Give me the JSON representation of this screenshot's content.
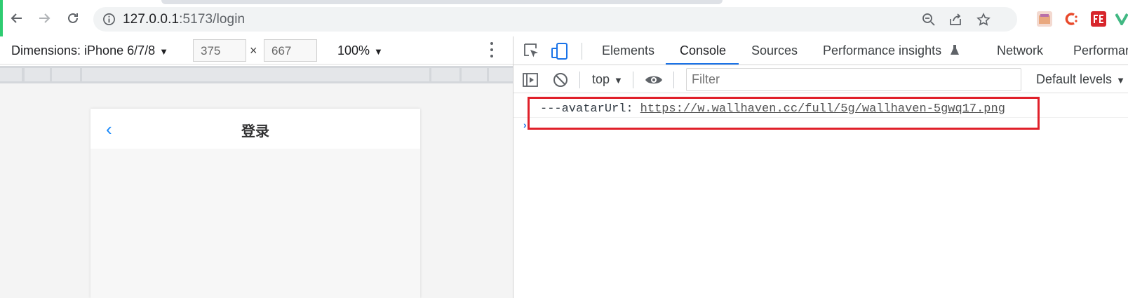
{
  "browser": {
    "url_host": "127.0.0.1",
    "url_path": ":5173/login"
  },
  "device_toolbar": {
    "dimensions_label": "Dimensions: iPhone 6/7/8",
    "width_value": "375",
    "times": "×",
    "height_value": "667",
    "zoom": "100%"
  },
  "phone": {
    "back_glyph": "‹",
    "title": "登录"
  },
  "devtools": {
    "tabs": [
      {
        "label": "Elements"
      },
      {
        "label": "Console"
      },
      {
        "label": "Sources"
      },
      {
        "label": "Performance insights"
      },
      {
        "label": "Network"
      },
      {
        "label": "Performar"
      }
    ],
    "active_tab": "Console",
    "context": "top",
    "filter_placeholder": "Filter",
    "levels": "Default levels"
  },
  "console": {
    "log_prefix": "---avatarUrl:",
    "log_link": "https://w.wallhaven.cc/full/5g/wallhaven-5gwq17.png",
    "prompt": "›"
  },
  "colors": {
    "accent": "#1a73e8",
    "highlight": "#e0202a",
    "back_arrow": "#1989fa"
  }
}
